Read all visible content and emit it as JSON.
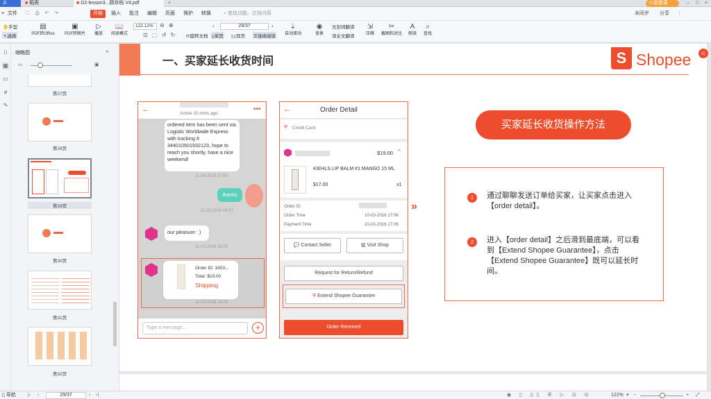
{
  "titlebar": {
    "tabs": [
      "Ji",
      "稻壳",
      "D2-lesson3...顾存档 V4.pdf"
    ],
    "right_tabs": [
      "+"
    ],
    "login_label": "小张登录"
  },
  "menubar": {
    "file_label": "文件",
    "items": [
      "开始",
      "插入",
      "批注",
      "编辑",
      "页面",
      "保护",
      "转换"
    ],
    "active": "开始",
    "search_placeholder": "查找功能、文档内容",
    "right": [
      "未同步",
      "分享"
    ]
  },
  "toolbar": {
    "hand_label": "手型",
    "select_label": "选择",
    "buttons": [
      "PDF转Office",
      "PDF转图片",
      "播放",
      "阅读模式"
    ],
    "zoom_value": "122.12%",
    "page_value": "29/37",
    "rotate_label": "旋转文档",
    "single_label": "单页",
    "double_label": "双页",
    "continuous_label": "连续阅读",
    "auto_scroll_label": "自动滚动",
    "right_buttons": [
      "背景",
      "全文翻译",
      "压缩",
      "截图和对比",
      "朗读",
      "查找"
    ],
    "translate_label": "划词翻译"
  },
  "thumbnails": {
    "title": "缩略图",
    "items": [
      {
        "label": "第27页"
      },
      {
        "label": "第28页"
      },
      {
        "label": "第29页"
      },
      {
        "label": "第30页"
      },
      {
        "label": "第31页"
      },
      {
        "label": "第32页"
      }
    ]
  },
  "slide": {
    "heading": "一、买家延长收货时间",
    "brand": "Shopee",
    "chat": {
      "status": "Active 20 mins ago",
      "message1": "ordered item has been sent via Logistic Worldwide Express with tracking # 344010501932123, hope to reach you shortly, have a nice weekend!",
      "time1": "11-03-2016 17:50",
      "thanks": "thanks",
      "time2": "11-03-2016 18:07",
      "reply": "our pleasure : )",
      "time3": "11-03-2016 18:33",
      "order_id": "Order ID: 1603...",
      "order_total": "Total: $19.00",
      "order_status": "Shipping",
      "time4": "11-03-2016 18:09",
      "input_placeholder": "Type a message..."
    },
    "order": {
      "title": "Order Detail",
      "payment_method": "Credit Card",
      "shop_total": "$19.00",
      "product_name": "KIEHLS LIP BALM #1 MANGO 15 ML",
      "product_price": "$17.00",
      "product_qty": "x1",
      "rows": [
        {
          "label": "Order ID",
          "value": ""
        },
        {
          "label": "Order Time",
          "value": "10-03-2016 17:06"
        },
        {
          "label": "Payment Time",
          "value": "10-03-2016 17:06"
        }
      ],
      "contact_seller": "Contact Seller",
      "visit_shop": "Visit Shop",
      "request_return": "Request for Return/Refund",
      "extend_guarantee": "Extend Shopee Guarantee",
      "order_received": "Order Received"
    },
    "method_button": "买家延长收货操作方法",
    "steps": [
      {
        "num": "1",
        "text": "通过聊聊发送订单给买家，让买家点击进入【order detail】。"
      },
      {
        "num": "2",
        "text": "进入【order detail】之后滑到最底端，可以看到【Extend Shopee Guarantee】，点击【Extend Shopee Guarantee】既可以延长时间。"
      }
    ]
  },
  "statusbar": {
    "nav_label": "导航",
    "page_value": "29/37",
    "zoom_value": "122%"
  },
  "colors": {
    "brand": "#ee4d2d",
    "pink": "#e0338b"
  }
}
